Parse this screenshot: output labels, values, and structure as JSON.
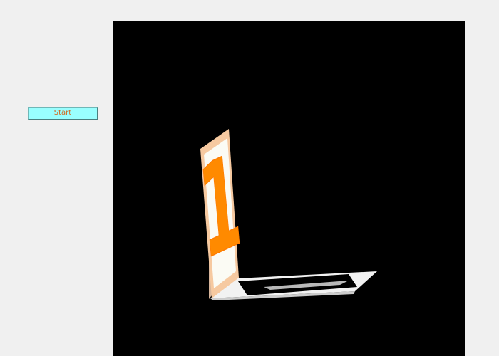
{
  "controls": {
    "start_label": "Start"
  },
  "scene": {
    "card_glyph": "1",
    "colors": {
      "background": "#000000",
      "card_face": "#fbfbf4",
      "card_border": "#f6c9a0",
      "glyph": "#ff8a00",
      "floor": "#f2f2f2",
      "button_bg": "#99ffff",
      "button_text": "#d2691e"
    }
  }
}
